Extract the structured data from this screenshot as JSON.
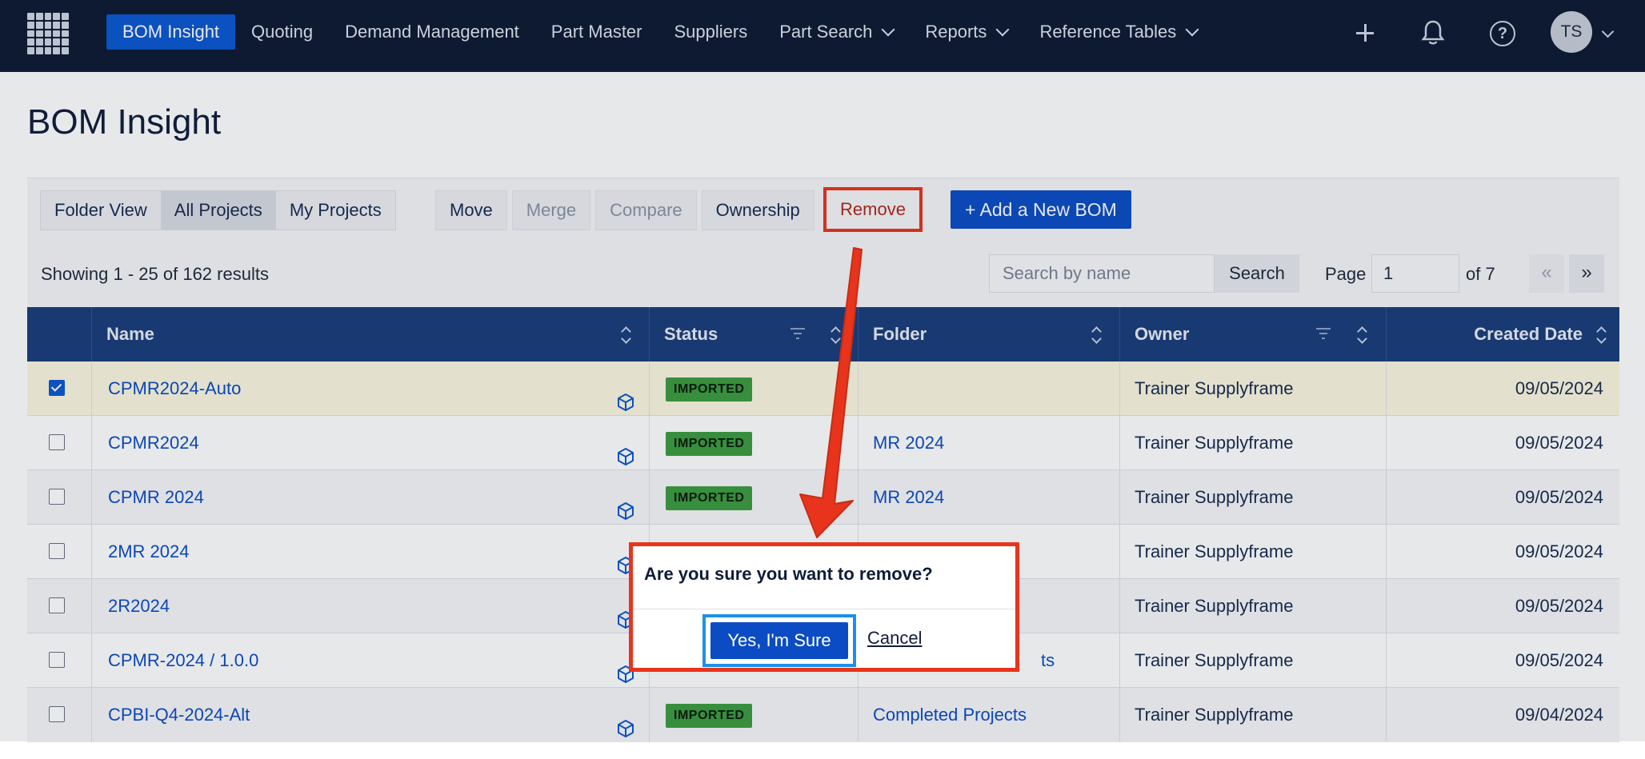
{
  "nav": {
    "items": [
      {
        "label": "BOM Insight",
        "active": true,
        "dropdown": false
      },
      {
        "label": "Quoting",
        "dropdown": false
      },
      {
        "label": "Demand Management",
        "dropdown": false
      },
      {
        "label": "Part Master",
        "dropdown": false
      },
      {
        "label": "Suppliers",
        "dropdown": false
      },
      {
        "label": "Part Search",
        "dropdown": true
      },
      {
        "label": "Reports",
        "dropdown": true
      },
      {
        "label": "Reference Tables",
        "dropdown": true
      }
    ],
    "help_glyph": "?",
    "avatar_initials": "TS",
    "icons": [
      "apps-grid-icon",
      "plus-icon",
      "bell-icon",
      "help-icon",
      "chevron-down-icon"
    ]
  },
  "page": {
    "title": "BOM Insight"
  },
  "toolbar": {
    "view_buttons": [
      "Folder View",
      "All Projects",
      "My Projects"
    ],
    "selected_view": "All Projects",
    "action_buttons": [
      "Move",
      "Merge",
      "Compare",
      "Ownership"
    ],
    "disabled_actions": [
      "Merge",
      "Compare"
    ],
    "remove_label": "Remove",
    "add_label": "+ Add a New BOM"
  },
  "results": {
    "summary": "Showing 1 - 25 of 162 results",
    "search_placeholder": "Search by name",
    "search_button": "Search",
    "page_label": "Page",
    "page_value": "1",
    "page_of": "of 7",
    "prev": "«",
    "next": "»"
  },
  "table": {
    "columns": [
      "Name",
      "Status",
      "Folder",
      "Owner",
      "Created Date"
    ],
    "rows": [
      {
        "name": "CPMR2024-Auto",
        "status": "IMPORTED",
        "folder": "",
        "owner": "Trainer Supplyframe",
        "date": "09/05/2024",
        "checked": true
      },
      {
        "name": "CPMR2024",
        "status": "IMPORTED",
        "folder": "MR 2024",
        "owner": "Trainer Supplyframe",
        "date": "09/05/2024",
        "checked": false
      },
      {
        "name": "CPMR 2024",
        "status": "IMPORTED",
        "folder": "MR 2024",
        "owner": "Trainer Supplyframe",
        "date": "09/05/2024",
        "checked": false
      },
      {
        "name": "2MR 2024",
        "status": "",
        "folder": "",
        "owner": "Trainer Supplyframe",
        "date": "09/05/2024",
        "checked": false
      },
      {
        "name": "2R2024",
        "status": "",
        "folder": "",
        "owner": "Trainer Supplyframe",
        "date": "09/05/2024",
        "checked": false
      },
      {
        "name": "CPMR-2024 / 1.0.0",
        "status": "",
        "folder": "ts",
        "owner": "Trainer Supplyframe",
        "date": "09/05/2024",
        "checked": false
      },
      {
        "name": "CPBI-Q4-2024-Alt",
        "status": "IMPORTED",
        "folder": "Completed Projects",
        "owner": "Trainer Supplyframe",
        "date": "09/04/2024",
        "checked": false
      }
    ]
  },
  "dialog": {
    "question": "Are you sure you want to remove?",
    "confirm": "Yes, I'm Sure",
    "cancel": "Cancel"
  },
  "colors": {
    "nav_bg": "#0d1a33",
    "accent": "#0b4cc4",
    "header_bg": "#1a3d7a",
    "imported_badge": "#3c9b3f",
    "annotation_red": "#e8341c",
    "annotation_blue": "#1e90e8"
  }
}
